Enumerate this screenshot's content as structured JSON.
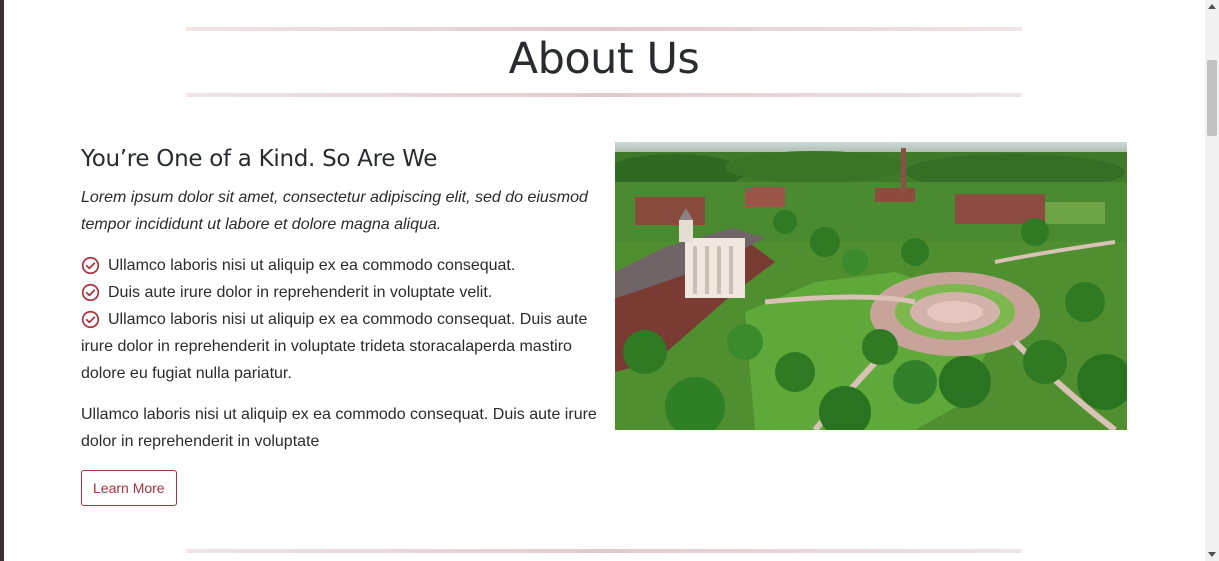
{
  "about": {
    "title": "About Us",
    "subtitle": "You’re One of a Kind. So Are We",
    "lead": "Lorem ipsum dolor sit amet, consectetur adipiscing elit, sed do eiusmod tempor incididunt ut labore et dolore magna aliqua.",
    "checklist": [
      "Ullamco laboris nisi ut aliquip ex ea commodo consequat.",
      "Duis aute irure dolor in reprehenderit in voluptate velit.",
      "Ullamco laboris nisi ut aliquip ex ea commodo consequat. Duis aute irure dolor in reprehenderit in voluptate trideta storacalaperda mastiro dolore eu fugiat nulla pariatur."
    ],
    "body": "Ullamco laboris nisi ut aliquip ex ea commodo consequat. Duis aute irure dolor in reprehenderit in voluptate",
    "button_label": "Learn More",
    "check_icon": "check-circle-icon",
    "image_subject": "campus-aerial-photo"
  },
  "colors": {
    "accent": "#a8323f",
    "rule": "#e3c9cc",
    "text": "#2b2b2b"
  }
}
